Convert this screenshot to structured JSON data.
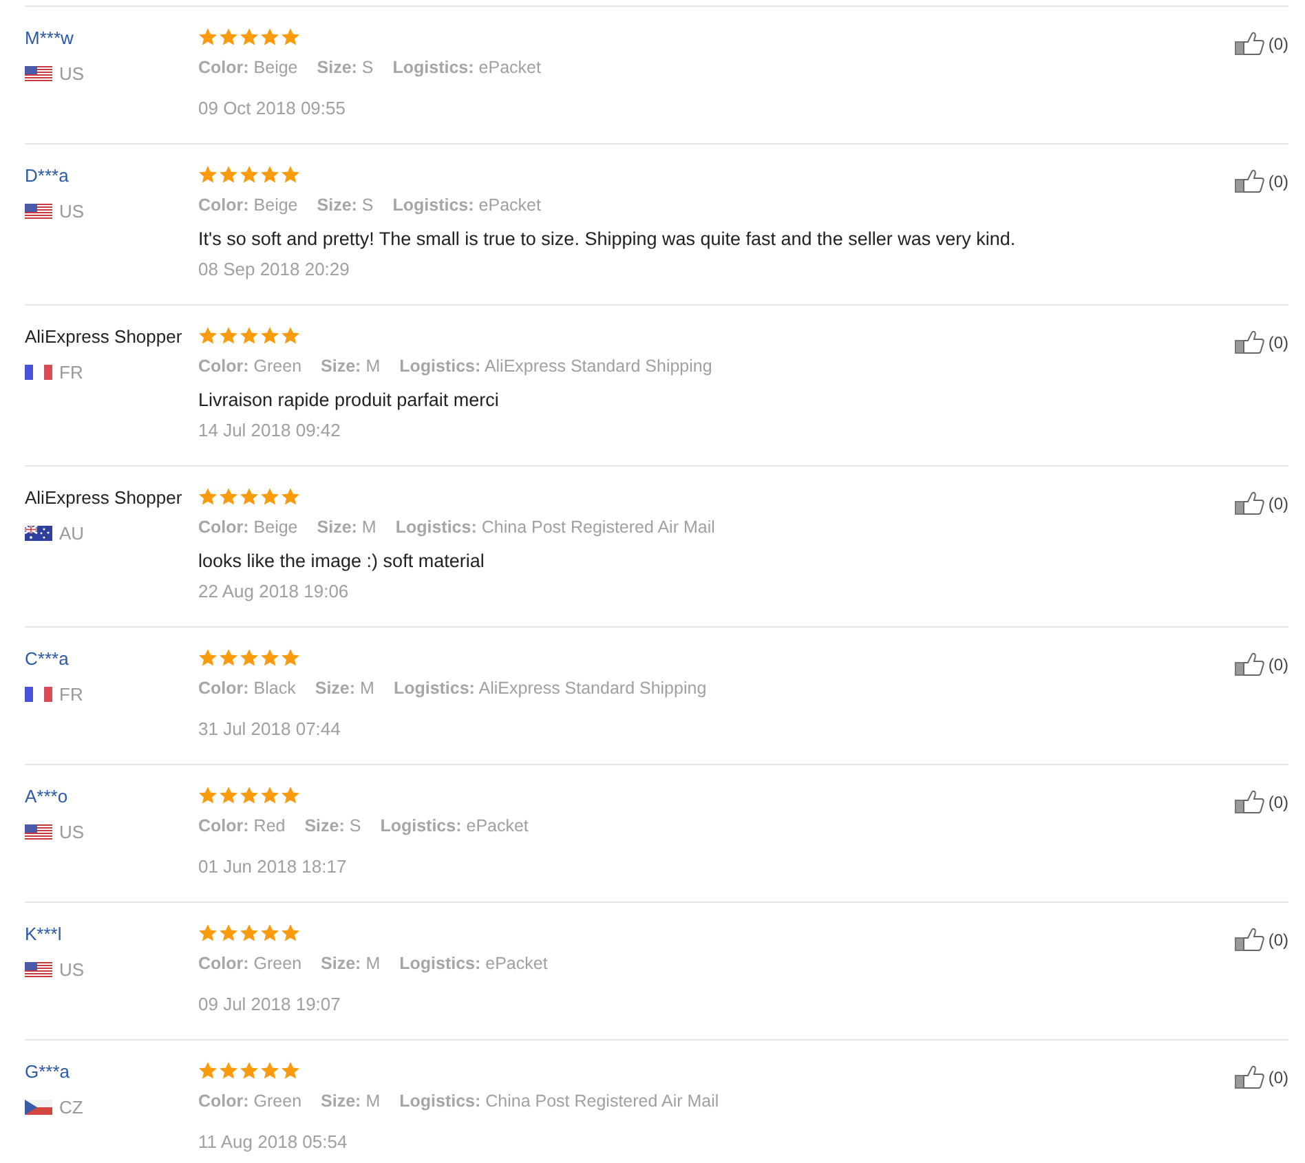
{
  "reviews": [
    {
      "buyer": {
        "kind": "link",
        "name": "M***w"
      },
      "flag": {
        "kind": "us"
      },
      "country": "US",
      "stars": 5,
      "attributes": [
        "**Color:** Beige",
        "**Size:** S",
        "**Logistics:** ePacket"
      ],
      "date": "09 Oct 2018 09:55",
      "helpful_count": "(0)"
    },
    {
      "buyer": {
        "kind": "link",
        "name": "D***a"
      },
      "flag": {
        "kind": "us"
      },
      "country": "US",
      "stars": 5,
      "attributes": [
        "**Color:** Beige",
        "**Size:** S",
        "**Logistics:** ePacket"
      ],
      "comment": "It's so soft and pretty! The small is true to size. Shipping was quite fast and the seller was very kind.",
      "date": "08 Sep 2018 20:29",
      "helpful_count": "(0)"
    },
    {
      "buyer": {
        "kind": "plain",
        "name": "AliExpress Shopper"
      },
      "flag": {
        "kind": "fr"
      },
      "country": "FR",
      "stars": 5,
      "attributes": [
        "**Color:** Green",
        "**Size:** M",
        "**Logistics:** AliExpress Standard Shipping"
      ],
      "comment": "Livraison rapide produit parfait merci",
      "date": "14 Jul 2018 09:42",
      "helpful_count": "(0)"
    },
    {
      "buyer": {
        "kind": "plain",
        "name": "AliExpress Shopper"
      },
      "flag": {
        "kind": "au"
      },
      "country": "AU",
      "stars": 5,
      "attributes": [
        "**Color:** Beige",
        "**Size:** M",
        "**Logistics:** China Post Registered Air Mail"
      ],
      "comment": "looks like the image :) soft material",
      "date": "22 Aug 2018 19:06",
      "helpful_count": "(0)"
    },
    {
      "buyer": {
        "kind": "link",
        "name": "C***a"
      },
      "flag": {
        "kind": "fr"
      },
      "country": "FR",
      "stars": 5,
      "attributes": [
        "**Color:** Black",
        "**Size:** M",
        "**Logistics:** AliExpress Standard Shipping"
      ],
      "date": "31 Jul 2018 07:44",
      "helpful_count": "(0)"
    },
    {
      "buyer": {
        "kind": "link",
        "name": "A***o"
      },
      "flag": {
        "kind": "us"
      },
      "country": "US",
      "stars": 5,
      "attributes": [
        "**Color:** Red",
        "**Size:** S",
        "**Logistics:** ePacket"
      ],
      "date": "01 Jun 2018 18:17",
      "helpful_count": "(0)"
    },
    {
      "buyer": {
        "kind": "link",
        "name": "K***l"
      },
      "flag": {
        "kind": "us"
      },
      "country": "US",
      "stars": 5,
      "attributes": [
        "**Color:** Green",
        "**Size:** M",
        "**Logistics:** ePacket"
      ],
      "date": "09 Jul 2018 19:07",
      "helpful_count": "(0)"
    },
    {
      "buyer": {
        "kind": "link",
        "name": "G***a"
      },
      "flag": {
        "kind": "cz"
      },
      "country": "CZ",
      "stars": 5,
      "attributes": [
        "**Color:** Green",
        "**Size:** M",
        "**Logistics:** China Post Registered Air Mail"
      ],
      "date": "11 Aug 2018 05:54",
      "helpful_count": "(0)"
    }
  ]
}
